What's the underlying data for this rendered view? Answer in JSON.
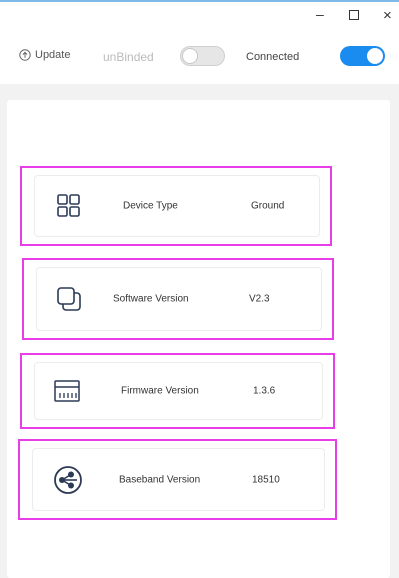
{
  "window_controls": {
    "minimize": "–",
    "close": "×"
  },
  "toolbar": {
    "update_label": "Update",
    "unbinded_label": "unBinded",
    "unbinded_toggle_on": false,
    "connected_label": "Connected",
    "connected_toggle_on": true
  },
  "colors": {
    "accent": "#1a8cf0",
    "highlight": "#e83ee8"
  },
  "device_info": [
    {
      "icon": "grid-icon",
      "label": "Device Type",
      "value": "Ground"
    },
    {
      "icon": "layers-icon",
      "label": "Software Version",
      "value": "V2.3"
    },
    {
      "icon": "firmware-icon",
      "label": "Firmware Version",
      "value": "1.3.6"
    },
    {
      "icon": "baseband-icon",
      "label": "Baseband Version",
      "value": "18510"
    }
  ]
}
